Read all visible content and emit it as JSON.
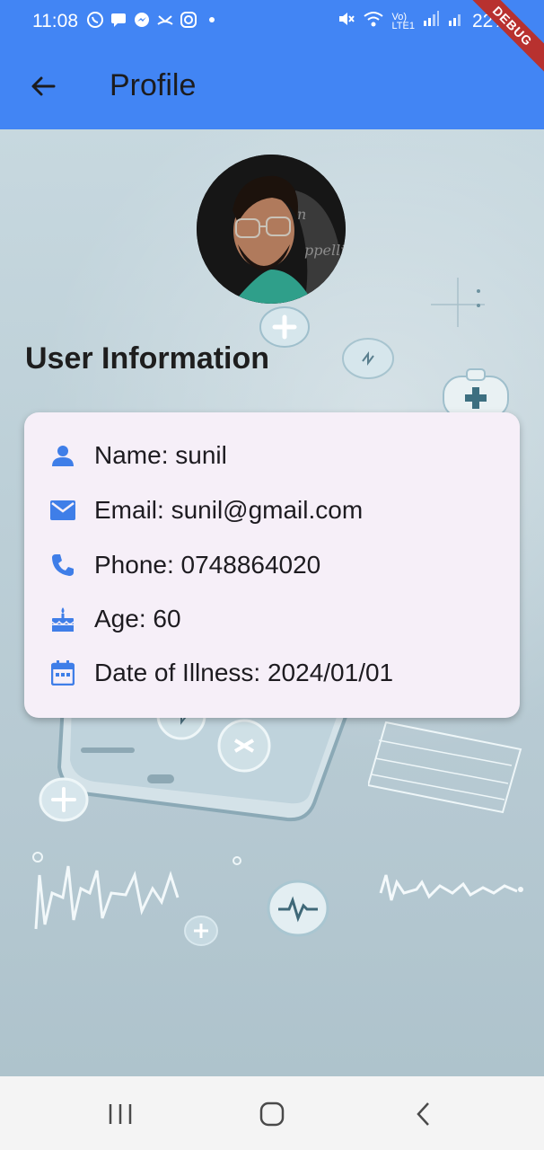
{
  "status_bar": {
    "time": "11:08",
    "battery": "22%"
  },
  "app_bar": {
    "title": "Profile"
  },
  "debug_banner": "DEBUG",
  "section_title": "User Information",
  "user_info": {
    "name": "Name: sunil",
    "email": "Email: sunil@gmail.com",
    "phone": "Phone: 0748864020",
    "age": "Age: 60",
    "date_of_illness": "Date of Illness: 2024/01/01"
  },
  "colors": {
    "accent": "#4285f4",
    "card_bg": "#f6eff8",
    "icon": "#3f7ee8"
  },
  "icons": {
    "back": "arrow-left-icon",
    "name": "person-icon",
    "email": "mail-icon",
    "phone": "phone-icon",
    "age": "cake-icon",
    "date": "calendar-icon"
  }
}
